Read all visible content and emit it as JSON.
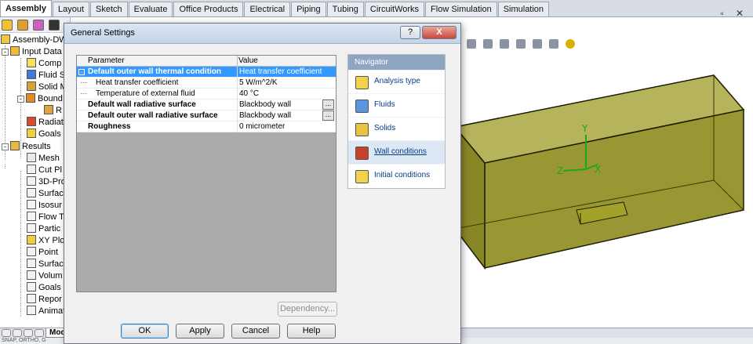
{
  "ribbon": {
    "tabs": [
      "Assembly",
      "Layout",
      "Sketch",
      "Evaluate",
      "Office Products",
      "Electrical",
      "Piping",
      "Tubing",
      "CircuitWorks",
      "Flow Simulation",
      "Simulation"
    ],
    "active": "Assembly"
  },
  "tree": {
    "items": [
      {
        "label": "Assembly-DWG",
        "icon": "assembly-icon"
      },
      {
        "label": "Input Data",
        "icon": "input-data-icon"
      },
      {
        "label": "Comp",
        "icon": "computational-domain-icon"
      },
      {
        "label": "Fluid S",
        "icon": "fluid-subdomain-icon"
      },
      {
        "label": "Solid M",
        "icon": "solid-material-icon"
      },
      {
        "label": "Bound",
        "icon": "boundary-condition-icon"
      },
      {
        "label": "R",
        "icon": "boundary-item-icon"
      },
      {
        "label": "Radiat",
        "icon": "radiation-icon"
      },
      {
        "label": "Goals",
        "icon": "goals-icon"
      },
      {
        "label": "Results",
        "icon": "results-icon"
      },
      {
        "label": "Mesh",
        "icon": "mesh-icon"
      },
      {
        "label": "Cut Pl",
        "icon": "cut-plot-icon"
      },
      {
        "label": "3D-Pro",
        "icon": "3d-profile-icon"
      },
      {
        "label": "Surfac",
        "icon": "surface-plot-icon"
      },
      {
        "label": "Isosur",
        "icon": "isosurface-icon"
      },
      {
        "label": "Flow T",
        "icon": "flow-trajectory-icon"
      },
      {
        "label": "Partic",
        "icon": "particle-study-icon"
      },
      {
        "label": "XY Plo",
        "icon": "xy-plot-icon"
      },
      {
        "label": "Point",
        "icon": "point-params-icon"
      },
      {
        "label": "Surfac",
        "icon": "surface-params-icon"
      },
      {
        "label": "Volum",
        "icon": "volume-params-icon"
      },
      {
        "label": "Goals",
        "icon": "goal-plot-icon"
      },
      {
        "label": "Repor",
        "icon": "report-icon"
      },
      {
        "label": "Animat",
        "icon": "animation-icon"
      }
    ]
  },
  "bottom": {
    "model_tab": "Mod",
    "status": "SNAP, ORTHO, G"
  },
  "dialog": {
    "title": "General Settings",
    "help_label": "?",
    "close_label": "X",
    "grid": {
      "col_parameter": "Parameter",
      "col_value": "Value",
      "rows": [
        {
          "parameter": "Default outer wall thermal condition",
          "value": "Heat transfer coefficient",
          "style": "selected"
        },
        {
          "parameter": "Heat transfer coefficient",
          "value": "5 W/m^2/K",
          "style": "child"
        },
        {
          "parameter": "Temperature of external fluid",
          "value": "40 °C",
          "style": "child"
        },
        {
          "parameter": "Default wall radiative surface",
          "value": "Blackbody wall",
          "style": "bold",
          "browse": "..."
        },
        {
          "parameter": "Default outer wall radiative surface",
          "value": "Blackbody wall",
          "style": "bold",
          "browse": "..."
        },
        {
          "parameter": "Roughness",
          "value": "0 micrometer",
          "style": "bold"
        }
      ]
    },
    "dependency_label": "Dependency...",
    "buttons": {
      "ok": "OK",
      "apply": "Apply",
      "cancel": "Cancel",
      "help": "Help"
    },
    "navigator": {
      "title": "Navigator",
      "items": [
        {
          "label": "Analysis type",
          "icon": "analysis-type-icon"
        },
        {
          "label": "Fluids",
          "icon": "fluids-icon"
        },
        {
          "label": "Solids",
          "icon": "solids-icon"
        },
        {
          "label": "Wall conditions",
          "icon": "wall-conditions-icon",
          "active": true
        },
        {
          "label": "Initial conditions",
          "icon": "initial-conditions-icon"
        }
      ]
    }
  },
  "viewport": {
    "axes": {
      "x": "X",
      "y": "Y",
      "z": "Z"
    },
    "model_color": "#8c8a14"
  }
}
